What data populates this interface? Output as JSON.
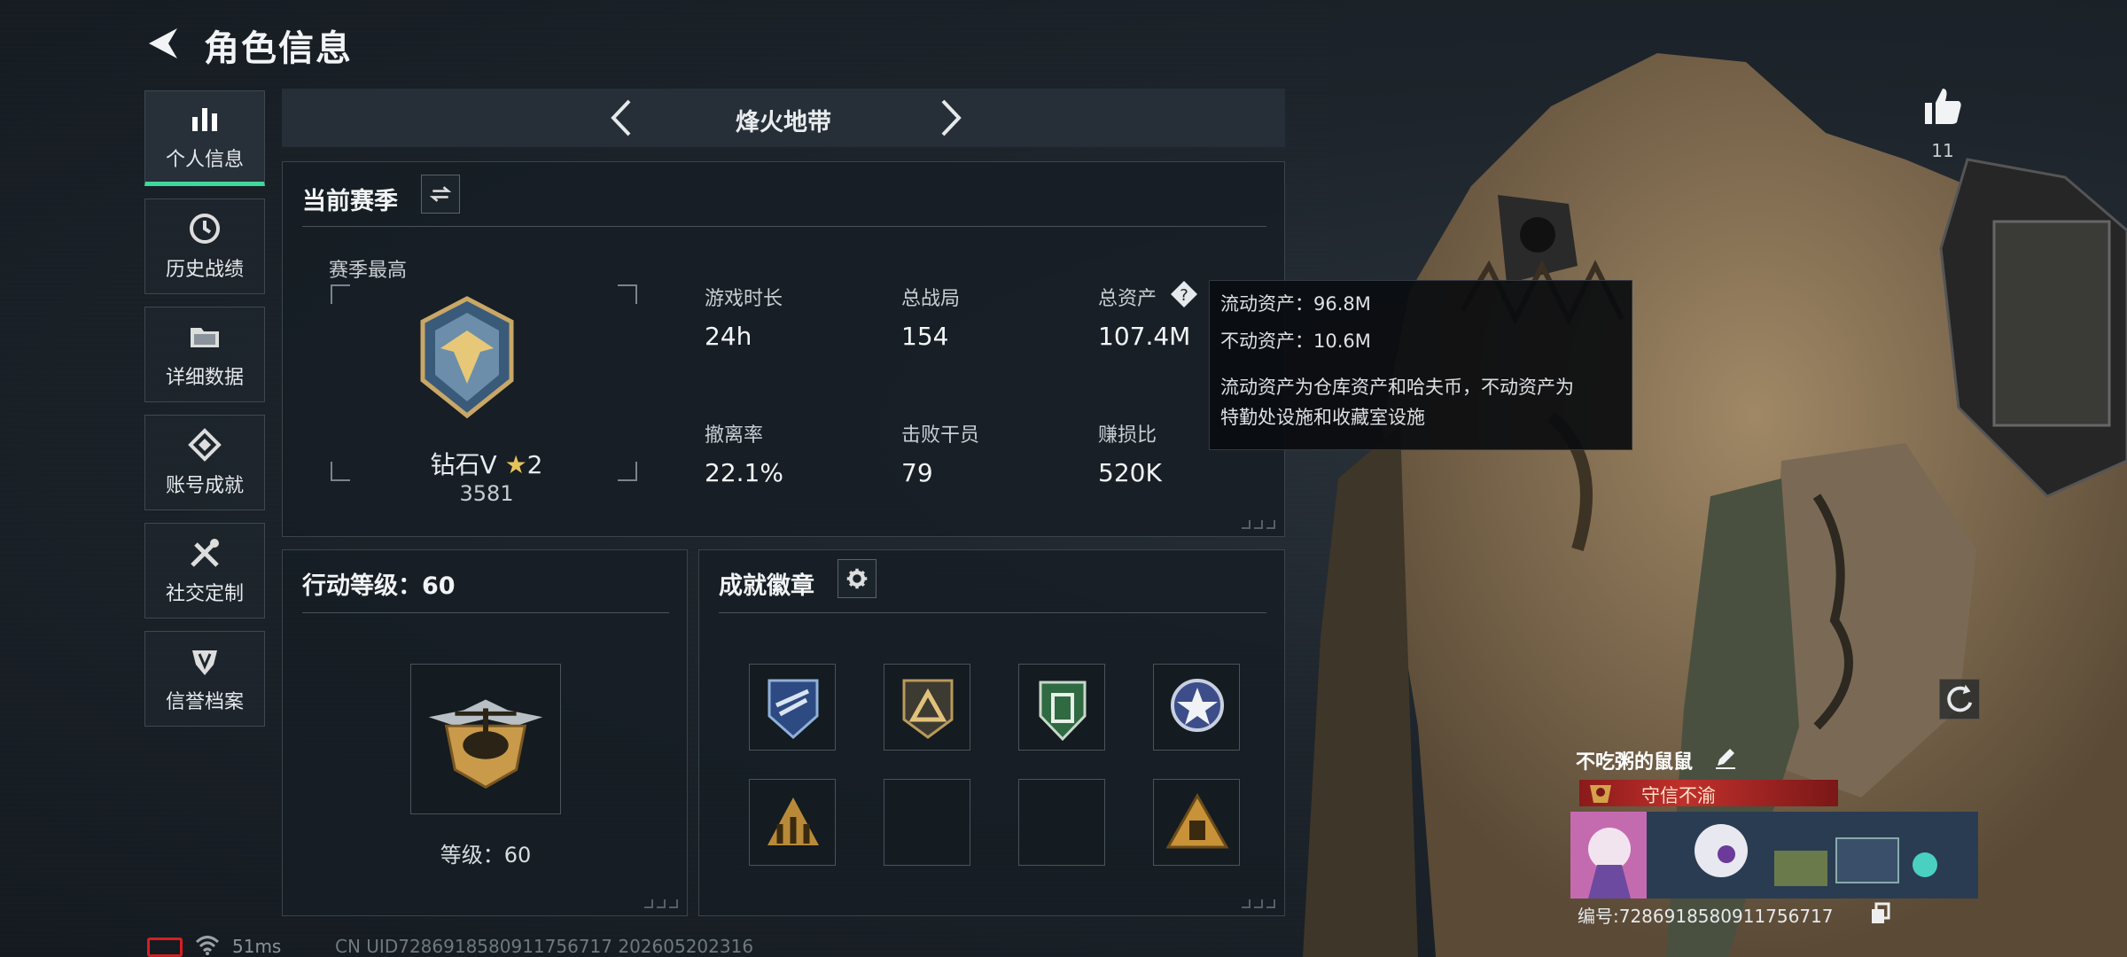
{
  "header": {
    "title": "角色信息",
    "back_icon": "back-arrow-icon"
  },
  "sidebar": {
    "items": [
      {
        "label": "个人信息",
        "icon": "bar-chart-icon",
        "active": true
      },
      {
        "label": "历史战绩",
        "icon": "clock-icon"
      },
      {
        "label": "详细数据",
        "icon": "folder-icon"
      },
      {
        "label": "账号成就",
        "icon": "diamond-icon"
      },
      {
        "label": "社交定制",
        "icon": "tools-icon"
      },
      {
        "label": "信誉档案",
        "icon": "shield-icon"
      }
    ]
  },
  "mode": {
    "title": "烽火地带"
  },
  "season": {
    "title": "当前赛季",
    "best_label": "赛季最高",
    "rank_name": "钻石V",
    "rank_stars": "2",
    "rank_score": "3581",
    "stats": [
      {
        "label": "游戏时长",
        "value": "24h"
      },
      {
        "label": "总战局",
        "value": "154"
      },
      {
        "label": "总资产",
        "value": "107.4M"
      },
      {
        "label": "撤离率",
        "value": "22.1%"
      },
      {
        "label": "击败干员",
        "value": "79"
      },
      {
        "label": "赚损比",
        "value": "520K"
      }
    ]
  },
  "tooltip": {
    "line1": "流动资产：96.8M",
    "line2": "不动资产：10.6M",
    "desc1": "流动资产为仓库资产和哈夫币，不动资产为",
    "desc2": "特勤处设施和收藏室设施"
  },
  "level": {
    "title": "行动等级：60",
    "level_label": "等级：60"
  },
  "achievements": {
    "title": "成就徽章",
    "badges": [
      "blue-emblem",
      "gold-triangle",
      "green-shield",
      "star-wreath",
      "gold-figures",
      "empty",
      "empty",
      "gold-warning"
    ]
  },
  "profile": {
    "likes": "11",
    "name": "不吃粥的鼠鼠",
    "motto": "守信不渝",
    "card_uid": "编号:7286918580911756717"
  },
  "status": {
    "ping": "51ms",
    "uid_line": "CN UID7286918580911756717 202605202316"
  },
  "colors": {
    "accent": "#3fd89c",
    "motto_red": "#c0302c",
    "battery_red": "#d52020"
  }
}
